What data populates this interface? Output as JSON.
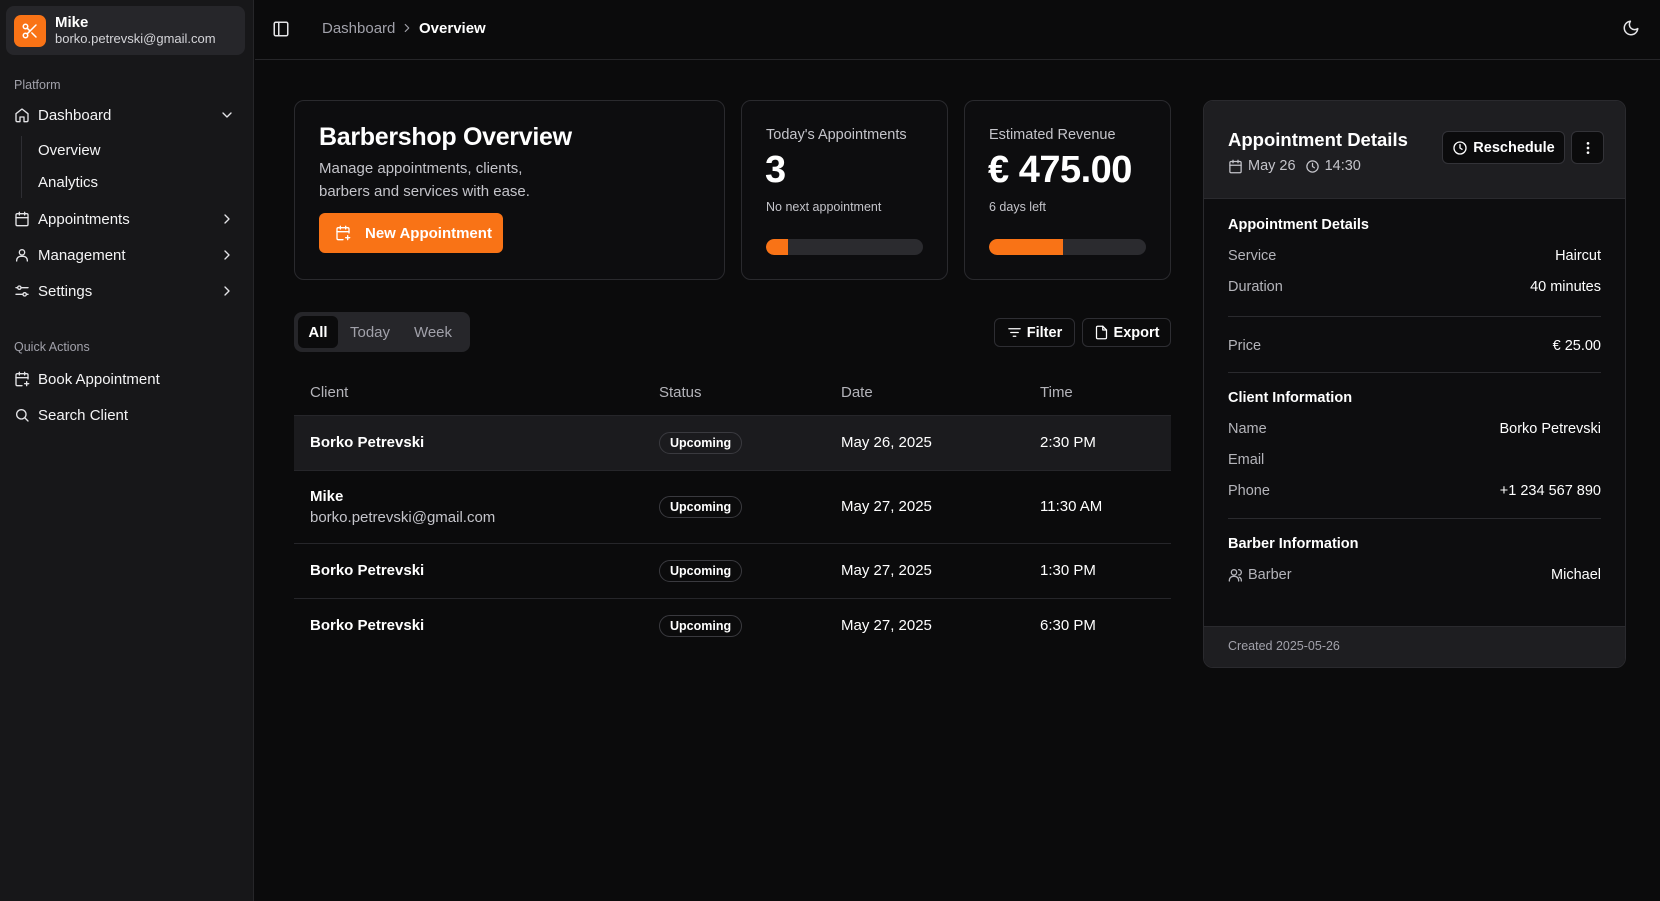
{
  "user": {
    "name": "Mike",
    "email": "borko.petrevski@gmail.com",
    "logo_icon": "scissors-icon"
  },
  "sidebar": {
    "platform_label": "Platform",
    "items": [
      {
        "label": "Dashboard",
        "icon": "home-icon",
        "expanded": true
      },
      {
        "label": "Appointments",
        "icon": "calendar-icon"
      },
      {
        "label": "Management",
        "icon": "user-icon"
      },
      {
        "label": "Settings",
        "icon": "sliders-icon"
      }
    ],
    "dashboard_sub": [
      "Overview",
      "Analytics"
    ],
    "quick_label": "Quick Actions",
    "quick": [
      {
        "label": "Book Appointment",
        "icon": "calendar-plus-icon"
      },
      {
        "label": "Search Client",
        "icon": "search-icon"
      }
    ]
  },
  "breadcrumb": {
    "parent": "Dashboard",
    "current": "Overview"
  },
  "overview": {
    "title": "Barbershop Overview",
    "description": "Manage appointments, clients, barbers and services with ease.",
    "new_button": "New Appointment"
  },
  "stats": [
    {
      "label": "Today's Appointments",
      "value": "3",
      "sub": "No next appointment",
      "progress": 0.14
    },
    {
      "label": "Estimated Revenue",
      "value": "€ 475.00",
      "sub": "6 days left",
      "progress": 0.47
    }
  ],
  "tabs": {
    "all": "All",
    "today": "Today",
    "week": "Week",
    "active": "All"
  },
  "actions": {
    "filter": "Filter",
    "export": "Export"
  },
  "table": {
    "headers": {
      "client": "Client",
      "status": "Status",
      "date": "Date",
      "time": "Time"
    },
    "rows": [
      {
        "client": "Borko Petrevski",
        "email": "",
        "status": "Upcoming",
        "date": "May 26, 2025",
        "time": "2:30 PM"
      },
      {
        "client": "Mike",
        "email": "borko.petrevski@gmail.com",
        "status": "Upcoming",
        "date": "May 27, 2025",
        "time": "11:30 AM"
      },
      {
        "client": "Borko Petrevski",
        "email": "",
        "status": "Upcoming",
        "date": "May 27, 2025",
        "time": "1:30 PM"
      },
      {
        "client": "Borko Petrevski",
        "email": "",
        "status": "Upcoming",
        "date": "May 27, 2025",
        "time": "6:30 PM"
      }
    ]
  },
  "detail": {
    "title": "Appointment Details",
    "date": "May 26",
    "time": "14:30",
    "reschedule": "Reschedule",
    "appointment_section": "Appointment Details",
    "service_label": "Service",
    "service": "Haircut",
    "duration_label": "Duration",
    "duration": "40 minutes",
    "price_label": "Price",
    "price": "€ 25.00",
    "client_section": "Client Information",
    "name_label": "Name",
    "name": "Borko Petrevski",
    "email_label": "Email",
    "email": "",
    "phone_label": "Phone",
    "phone": "+1 234 567 890",
    "barber_section": "Barber Information",
    "barber_label": "Barber",
    "barber": "Michael",
    "created": "Created 2025-05-26"
  },
  "colors": {
    "accent": "#f97316",
    "background": "#0b0b0c",
    "sidebar": "#171719"
  }
}
